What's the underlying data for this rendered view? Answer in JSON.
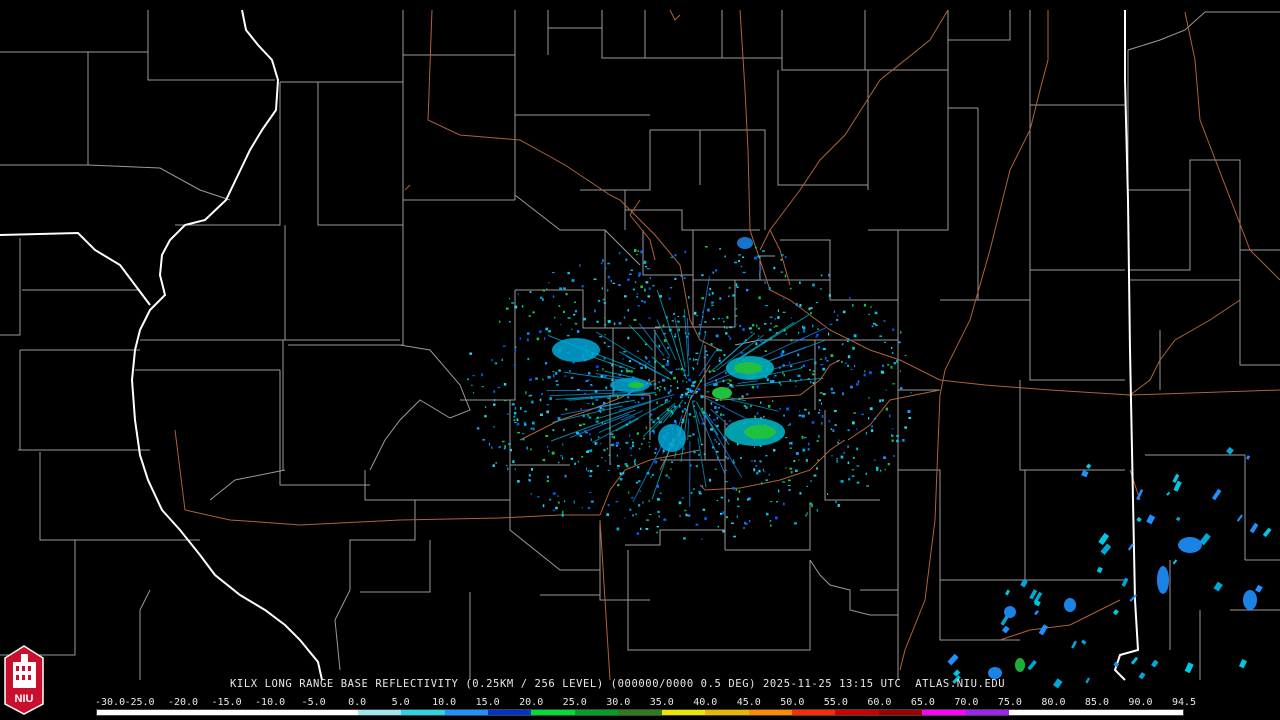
{
  "product": {
    "caption": "KILX LONG RANGE BASE REFLECTIVITY (0.25KM / 256 LEVEL) (000000/0000 0.5 DEG) 2025-11-25 13:15 UTC  ATLAS.NIU.EDU"
  },
  "logo": {
    "text": "NIU"
  },
  "color_scale": {
    "labels": [
      "-30.0",
      "-25.0",
      "-20.0",
      "-15.0",
      "-10.0",
      "-5.0",
      "0.0",
      "5.0",
      "10.0",
      "15.0",
      "20.0",
      "25.0",
      "30.0",
      "35.0",
      "40.0",
      "45.0",
      "50.0",
      "55.0",
      "60.0",
      "65.0",
      "70.0",
      "75.0",
      "80.0",
      "85.0",
      "90.0",
      "94.5"
    ],
    "colors": [
      "#ffffff",
      "#ffffff",
      "#ffffff",
      "#ffffff",
      "#ffffff",
      "#ffffff",
      "#9ee7ef",
      "#2fd3e6",
      "#1e90ff",
      "#0033cc",
      "#00dd33",
      "#00a020",
      "#2e7d1a",
      "#e8e800",
      "#e8b800",
      "#ff8c00",
      "#ff2a00",
      "#cc0000",
      "#990000",
      "#ff00ff",
      "#a020f0",
      "#ffffff",
      "#ffffff",
      "#ffffff",
      "#ffffff"
    ]
  },
  "map_colors": {
    "background": "#000000",
    "county_lines": "#9a9a9a",
    "state_lines": "#ffffff",
    "highways": "#b0623a"
  }
}
